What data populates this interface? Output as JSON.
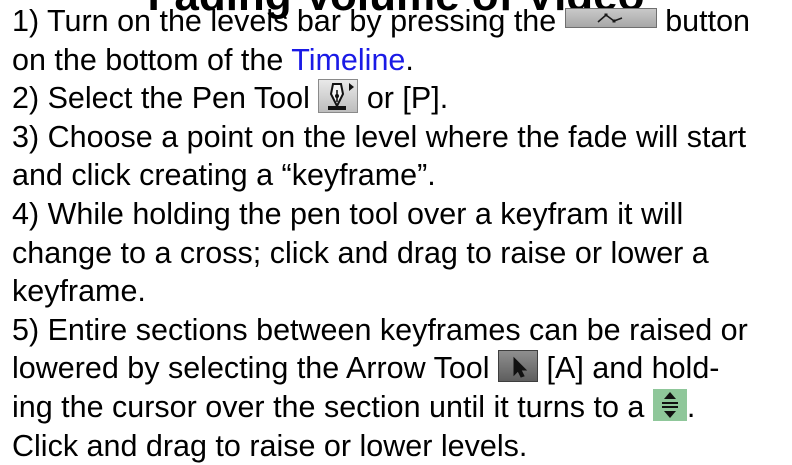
{
  "slide": {
    "title": "Fading Volume of Video",
    "steps": [
      {
        "line1_prefix": "1) Turn on the levels bar by pressing the",
        "line1_suffix": "button",
        "line2_prefix": "on the bottom of the",
        "link_text": "Timeline",
        "line2_suffix": "."
      },
      {
        "prefix": "2) Select the Pen Tool",
        "suffix": "or [P]."
      },
      {
        "line1": "3) Choose a point on the level where the fade will start",
        "line2": "and click creating a “keyframe”."
      },
      {
        "line1": "4) While holding the pen tool over a keyfram it will",
        "line2": "change to a cross; click and drag to raise or lower a",
        "line3": "keyframe."
      },
      {
        "line1": "5) Entire sections between keyframes can be raised or",
        "line2_prefix": "lowered by selecting the Arrow Tool",
        "line2_suffix": "[A] and hold-",
        "line3_prefix": "ing the cursor over the section until it turns to a",
        "line3_suffix": ".",
        "line4": "Click and drag to raise or lower levels."
      }
    ]
  },
  "icons": {
    "levels_button": "levels-bar-toggle-icon",
    "pen_tool": "pen-tool-icon",
    "arrow_tool": "arrow-tool-icon",
    "raise_lower_cursor": "up-down-cursor-icon"
  },
  "colors": {
    "text": "#000000",
    "link": "#1a1ae6",
    "cursor_icon_bg": "#8fc79a"
  }
}
